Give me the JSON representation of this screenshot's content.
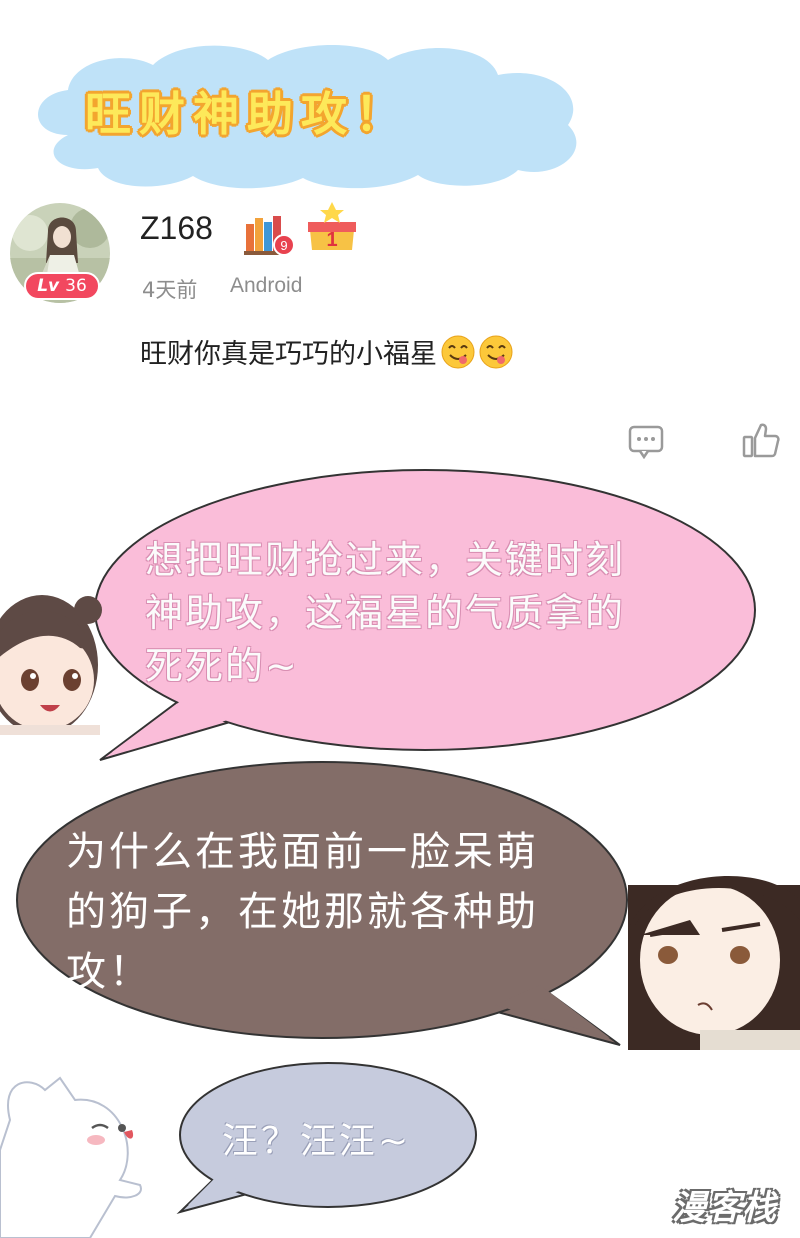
{
  "banner": {
    "title": "旺财神助攻！"
  },
  "comment": {
    "username": "Z168",
    "level_prefix": "Lv",
    "level": "36",
    "badge_books_count": "9",
    "badge_rank": "1",
    "time": "4天前",
    "platform": "Android",
    "text": "旺财你真是巧巧的小福星",
    "emoji": [
      "yum-face-icon",
      "yum-face-icon"
    ],
    "actions": [
      "reply-icon",
      "like-icon"
    ]
  },
  "bubbles": [
    {
      "speaker": "girl",
      "text": "想把旺财抢过来，关键时刻\n神助攻，这福星的气质拿的\n死死的~"
    },
    {
      "speaker": "man",
      "text": "为什么在我面前一脸呆萌\n的狗子，在她那就各种助\n攻！"
    },
    {
      "speaker": "dog",
      "text": "汪？汪汪~"
    }
  ],
  "colors": {
    "title_fill": "#fde95a",
    "title_outline": "#f3a52f",
    "cloud": "#bfe2f8",
    "bubble1": "#fabdd9",
    "bubble2": "#836d68",
    "bubble3": "#c6cbdd",
    "level_badge": "#f2485f"
  },
  "watermark": "漫客栈"
}
